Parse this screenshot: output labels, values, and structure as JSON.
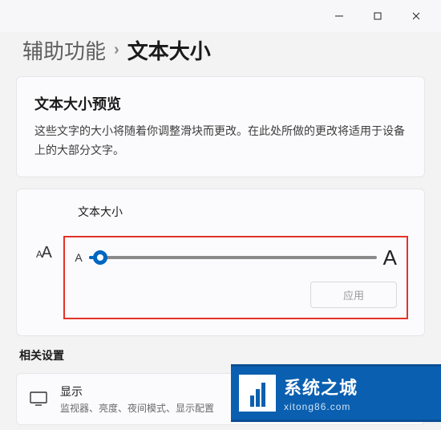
{
  "window": {
    "minimize": "minimize",
    "maximize": "maximize",
    "close": "close"
  },
  "breadcrumb": {
    "parent": "辅助功能",
    "separator": "›",
    "current": "文本大小"
  },
  "preview": {
    "title": "文本大小预览",
    "desc": "这些文字的大小将随着你调整滑块而更改。在此处所做的更改将适用于设备上的大部分文字。"
  },
  "textsize": {
    "label": "文本大小",
    "icon_small": "A",
    "icon_big": "A",
    "min_label": "A",
    "max_label": "A",
    "value_percent": 4,
    "apply": "应用"
  },
  "related": {
    "heading": "相关设置",
    "display": {
      "title": "显示",
      "subtitle": "监视器、亮度、夜间模式、显示配置"
    }
  },
  "watermark": {
    "line1": "系统之城",
    "line2": "xitong86.com"
  }
}
